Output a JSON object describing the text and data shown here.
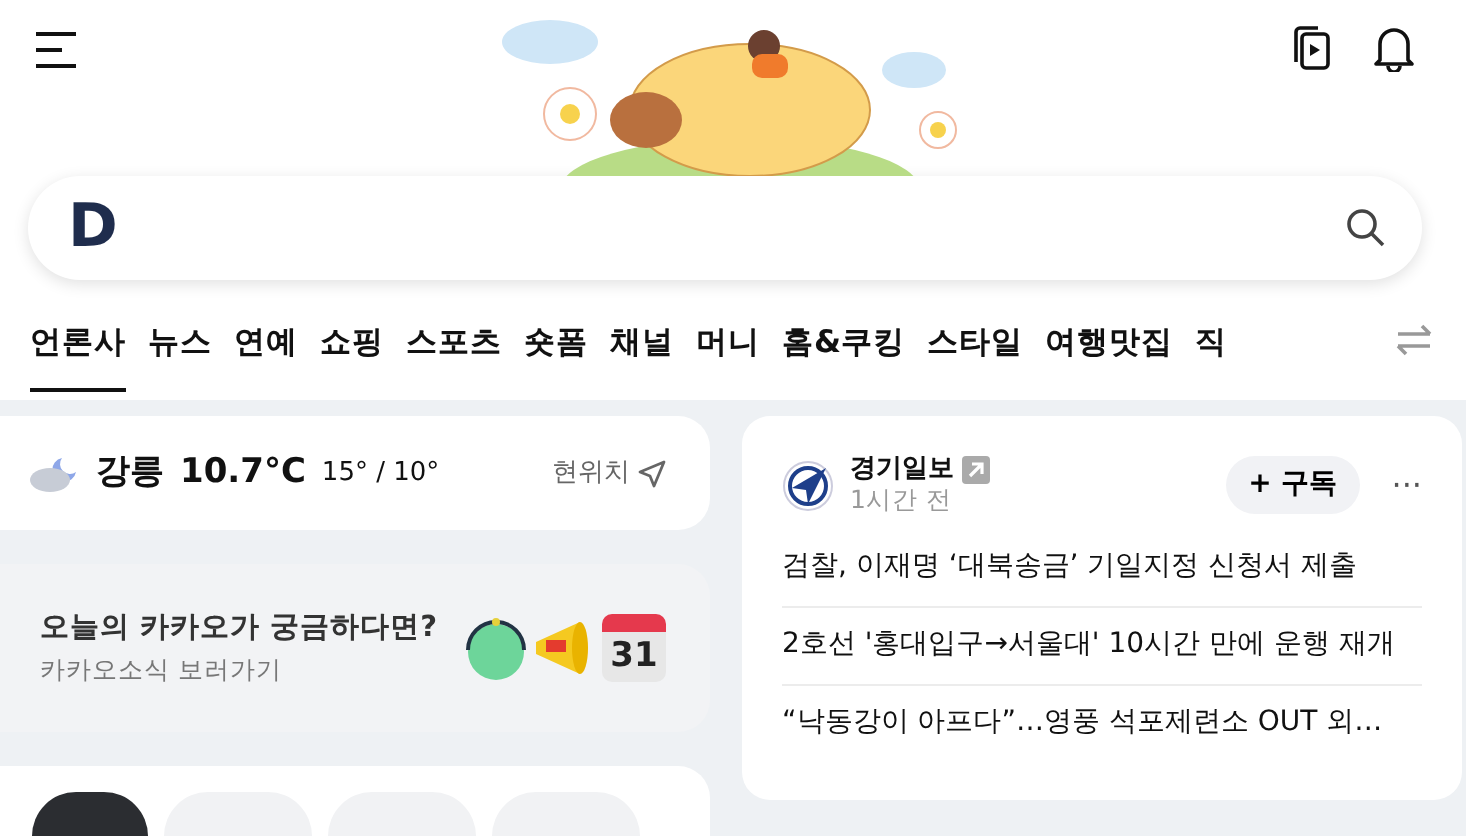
{
  "header": {
    "logo": "D"
  },
  "tabs": [
    {
      "label": "언론사",
      "selected": true
    },
    {
      "label": "뉴스",
      "selected": false
    },
    {
      "label": "연예",
      "selected": false
    },
    {
      "label": "쇼핑",
      "selected": false
    },
    {
      "label": "스포츠",
      "selected": false
    },
    {
      "label": "숏폼",
      "selected": false
    },
    {
      "label": "채널",
      "selected": false
    },
    {
      "label": "머니",
      "selected": false
    },
    {
      "label": "홈&쿠킹",
      "selected": false
    },
    {
      "label": "스타일",
      "selected": false
    },
    {
      "label": "여행맛집",
      "selected": false
    },
    {
      "label": "직",
      "selected": false
    }
  ],
  "weather": {
    "city": "강릉",
    "temperature": "10.7°C",
    "range": "15° / 10°",
    "location_label": "현위치"
  },
  "promo": {
    "title": "오늘의 카카오가 궁금하다면?",
    "subtitle": "카카오소식 보러가기",
    "calendar_day": "31"
  },
  "chips": [
    {
      "selected": true
    },
    {
      "selected": false
    },
    {
      "selected": false
    },
    {
      "selected": false
    }
  ],
  "press": {
    "name": "경기일보",
    "time": "1시간 전",
    "subscribe": "+ 구독",
    "more": "···",
    "headlines": [
      "검찰, 이재명 ‘대북송금’ 기일지정 신청서 제출",
      "2호선 '홍대입구→서울대' 10시간 만에 운행 재개",
      "“낙동강이 아프다”…영풍 석포제련소 OUT 외…"
    ]
  }
}
